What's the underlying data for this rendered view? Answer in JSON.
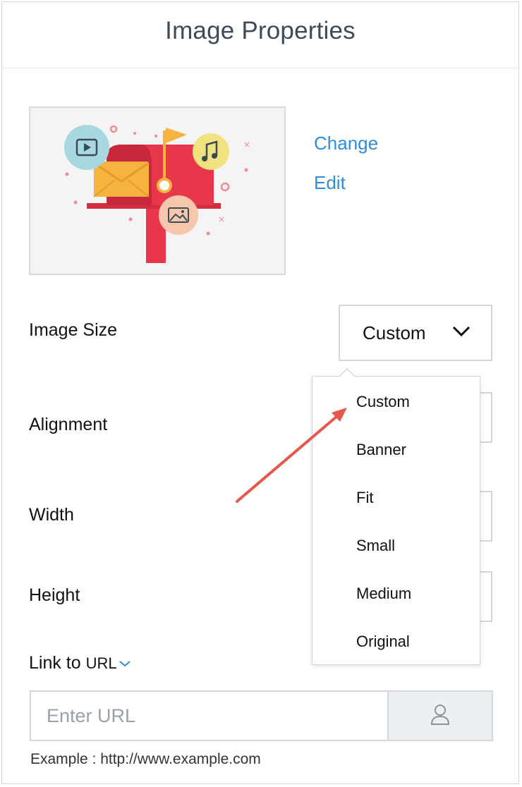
{
  "panel": {
    "title": "Image Properties"
  },
  "image_actions": {
    "change": "Change",
    "edit": "Edit"
  },
  "fields": {
    "image_size": "Image Size",
    "alignment": "Alignment",
    "width": "Width",
    "height": "Height",
    "link_to": "Link to",
    "link_type": "URL"
  },
  "image_size_select": {
    "value": "Custom"
  },
  "size_options": [
    "Custom",
    "Banner",
    "Fit",
    "Small",
    "Medium",
    "Original"
  ],
  "url": {
    "placeholder": "Enter URL",
    "value": "",
    "example": "Example : http://www.example.com"
  },
  "colors": {
    "link": "#2d8fdc",
    "annotation_arrow": "#e8574b",
    "mailbox": "#e8374a"
  }
}
